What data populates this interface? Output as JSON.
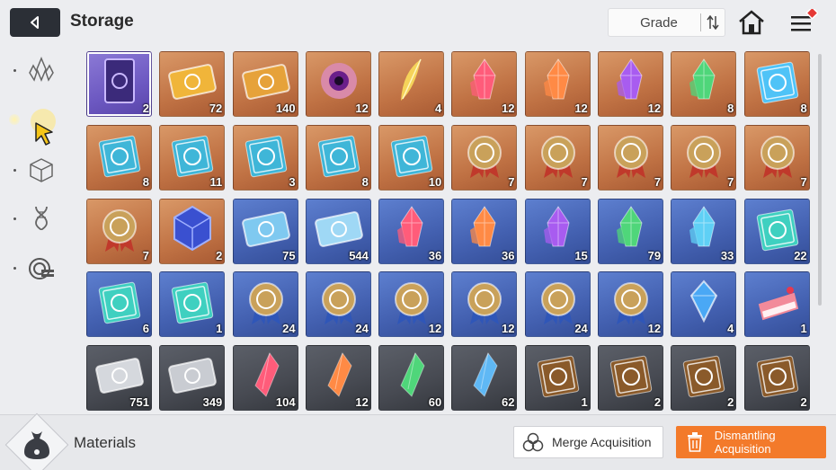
{
  "header": {
    "title": "Storage",
    "sort_label": "Grade"
  },
  "sidebar": {
    "items": [
      {
        "icon": "crystal-cluster-icon",
        "active": false
      },
      {
        "icon": "cursor-select-icon",
        "active": true
      },
      {
        "icon": "cube-icon",
        "active": false
      },
      {
        "icon": "dna-icon",
        "active": false
      },
      {
        "icon": "module-chip-icon",
        "active": false
      }
    ]
  },
  "items": [
    {
      "type": "tarot-card",
      "qty": "2",
      "bg": "purple",
      "color": "#6a4dc8"
    },
    {
      "type": "ticket",
      "qty": "72",
      "bg": "orange",
      "color": "#f0b53a"
    },
    {
      "type": "ticket",
      "qty": "140",
      "bg": "orange",
      "color": "#e6a23a"
    },
    {
      "type": "eye-orb",
      "qty": "12",
      "bg": "orange",
      "color": "#b03aa8"
    },
    {
      "type": "feather",
      "qty": "4",
      "bg": "orange",
      "color": "#f5d35a"
    },
    {
      "type": "crystal",
      "qty": "12",
      "bg": "orange",
      "color": "#ff5c7a"
    },
    {
      "type": "crystal",
      "qty": "12",
      "bg": "orange",
      "color": "#ff8a45"
    },
    {
      "type": "crystal",
      "qty": "12",
      "bg": "orange",
      "color": "#a85cf0"
    },
    {
      "type": "crystal",
      "qty": "8",
      "bg": "orange",
      "color": "#4fd67a"
    },
    {
      "type": "book",
      "qty": "8",
      "bg": "orange",
      "color": "#4fc3f7"
    },
    {
      "type": "book",
      "qty": "8",
      "bg": "orange",
      "color": "#3fb6d8"
    },
    {
      "type": "book",
      "qty": "11",
      "bg": "orange",
      "color": "#3fb6d8"
    },
    {
      "type": "book",
      "qty": "3",
      "bg": "orange",
      "color": "#3fb6d8"
    },
    {
      "type": "book",
      "qty": "8",
      "bg": "orange",
      "color": "#3fb6d8"
    },
    {
      "type": "book",
      "qty": "10",
      "bg": "orange",
      "color": "#3fb6d8"
    },
    {
      "type": "medal",
      "qty": "7",
      "bg": "orange",
      "color": "#c0392b"
    },
    {
      "type": "medal",
      "qty": "7",
      "bg": "orange",
      "color": "#c0392b"
    },
    {
      "type": "medal",
      "qty": "7",
      "bg": "orange",
      "color": "#c0392b"
    },
    {
      "type": "medal",
      "qty": "7",
      "bg": "orange",
      "color": "#c0392b"
    },
    {
      "type": "medal",
      "qty": "7",
      "bg": "orange",
      "color": "#c0392b"
    },
    {
      "type": "medal",
      "qty": "7",
      "bg": "orange",
      "color": "#c0392b"
    },
    {
      "type": "cube",
      "qty": "2",
      "bg": "orange",
      "color": "#3a50d0"
    },
    {
      "type": "ticket",
      "qty": "75",
      "bg": "blue",
      "color": "#7fc9f0"
    },
    {
      "type": "ticket",
      "qty": "544",
      "bg": "blue",
      "color": "#9fd8f5"
    },
    {
      "type": "crystal",
      "qty": "36",
      "bg": "blue",
      "color": "#ff5c7a"
    },
    {
      "type": "crystal",
      "qty": "36",
      "bg": "blue",
      "color": "#ff8a45"
    },
    {
      "type": "crystal",
      "qty": "15",
      "bg": "blue",
      "color": "#a85cf0"
    },
    {
      "type": "crystal",
      "qty": "79",
      "bg": "blue",
      "color": "#4fd67a"
    },
    {
      "type": "crystal",
      "qty": "33",
      "bg": "blue",
      "color": "#5fd0f5"
    },
    {
      "type": "book",
      "qty": "22",
      "bg": "blue",
      "color": "#3fd0c0"
    },
    {
      "type": "book",
      "qty": "6",
      "bg": "blue",
      "color": "#3fd0c0"
    },
    {
      "type": "book",
      "qty": "1",
      "bg": "blue",
      "color": "#3fd0c0"
    },
    {
      "type": "medal",
      "qty": "24",
      "bg": "blue",
      "color": "#2f56b8"
    },
    {
      "type": "medal",
      "qty": "24",
      "bg": "blue",
      "color": "#2f56b8"
    },
    {
      "type": "medal",
      "qty": "12",
      "bg": "blue",
      "color": "#2f56b8"
    },
    {
      "type": "medal",
      "qty": "12",
      "bg": "blue",
      "color": "#2f56b8"
    },
    {
      "type": "medal",
      "qty": "24",
      "bg": "blue",
      "color": "#2f56b8"
    },
    {
      "type": "medal",
      "qty": "12",
      "bg": "blue",
      "color": "#2f56b8"
    },
    {
      "type": "gem",
      "qty": "4",
      "bg": "blue",
      "color": "#4aa8f5"
    },
    {
      "type": "cake",
      "qty": "1",
      "bg": "blue",
      "color": "#f28a9a"
    },
    {
      "type": "ticket",
      "qty": "751",
      "bg": "gray",
      "color": "#d5d8dd"
    },
    {
      "type": "ticket",
      "qty": "349",
      "bg": "gray",
      "color": "#c9ccd2"
    },
    {
      "type": "shard",
      "qty": "104",
      "bg": "gray",
      "color": "#ff5c7a"
    },
    {
      "type": "shard",
      "qty": "12",
      "bg": "gray",
      "color": "#ff8a45"
    },
    {
      "type": "shard",
      "qty": "60",
      "bg": "gray",
      "color": "#4fd67a"
    },
    {
      "type": "shard",
      "qty": "62",
      "bg": "gray",
      "color": "#5fb8f5"
    },
    {
      "type": "book",
      "qty": "1",
      "bg": "gray",
      "color": "#8a5a2a"
    },
    {
      "type": "book",
      "qty": "2",
      "bg": "gray",
      "color": "#8a5a2a"
    },
    {
      "type": "book",
      "qty": "2",
      "bg": "gray",
      "color": "#8a5a2a"
    },
    {
      "type": "book",
      "qty": "2",
      "bg": "gray",
      "color": "#8a5a2a"
    }
  ],
  "footer": {
    "category_label": "Materials",
    "merge_label": "Merge Acquisition",
    "dismantle_label": "Dismantling Acquisition"
  },
  "colors": {
    "accent": "#f37a2a",
    "dark": "#2b2f36"
  }
}
